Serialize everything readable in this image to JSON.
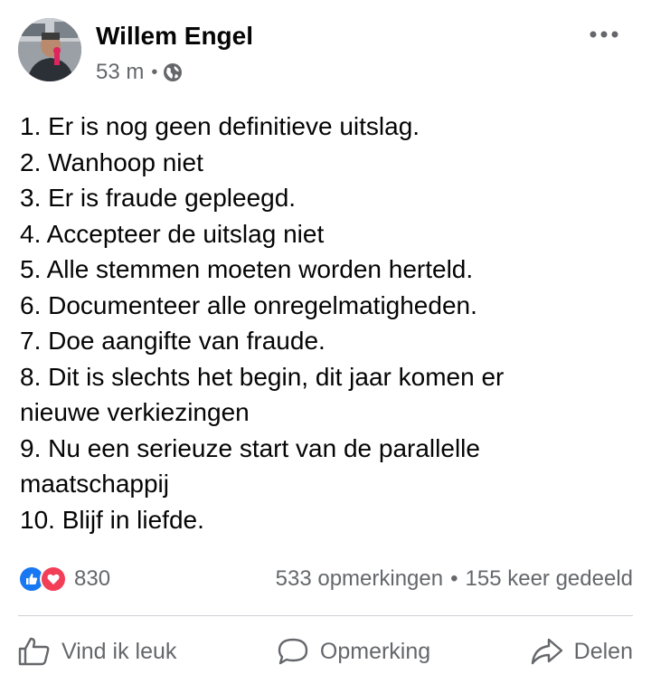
{
  "author": {
    "name": "Willem Engel",
    "time": "53 m",
    "dot": "•"
  },
  "post": {
    "lines": [
      "1. Er is nog geen definitieve uitslag.",
      "2. Wanhoop niet",
      "3. Er is fraude gepleegd.",
      "4. Accepteer de uitslag niet",
      "5. Alle stemmen moeten worden herteld.",
      "6. Documenteer alle onregelmatigheden.",
      "7. Doe aangifte van fraude.",
      "8. Dit is slechts het begin, dit jaar komen er",
      "nieuwe verkiezingen",
      "9. Nu een serieuze start van de parallelle",
      "maatschappij",
      "10. Blijf in liefde."
    ]
  },
  "stats": {
    "reactions_count": "830",
    "comments": "533 opmerkingen",
    "separator": "•",
    "shares": "155 keer gedeeld"
  },
  "actions": {
    "like": "Vind ik leuk",
    "comment": "Opmerking",
    "share": "Delen"
  },
  "colors": {
    "like_blue": "#1877f2",
    "love_red": "#f33e58",
    "secondary_text": "#65676b",
    "primary_text": "#050505"
  },
  "icons": [
    "globe-icon",
    "more-options-icon",
    "like-reaction-icon",
    "love-reaction-icon",
    "thumbs-up-icon",
    "comment-bubble-icon",
    "share-arrow-icon"
  ]
}
